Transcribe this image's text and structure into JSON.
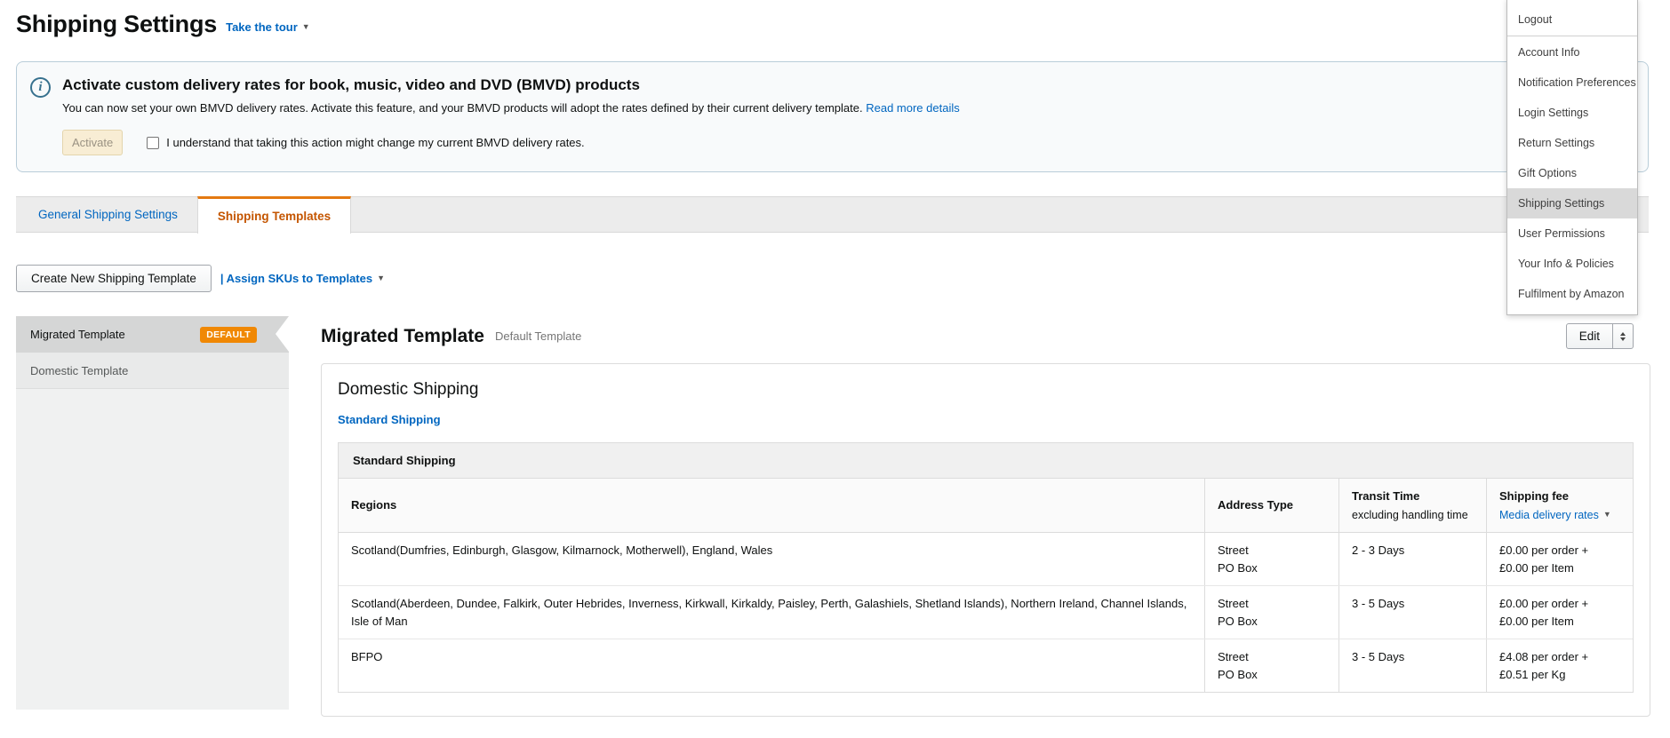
{
  "page": {
    "title": "Shipping Settings",
    "tour_link": "Take the tour"
  },
  "banner": {
    "info_icon": "i",
    "title": "Activate custom delivery rates for book, music, video and DVD (BMVD) products",
    "body": "You can now set your own BMVD delivery rates. Activate this feature, and your BMVD products will adopt the rates defined by their current delivery template.",
    "read_more": "Read more details",
    "activate_button": "Activate",
    "checkbox_label": "I understand that taking this action might change my current BMVD delivery rates.",
    "checkbox_checked": false
  },
  "tabs": {
    "general": "General Shipping Settings",
    "templates": "Shipping Templates",
    "active": "Shipping Templates"
  },
  "toolbar": {
    "create_button": "Create New Shipping Template",
    "assign_link": "| Assign SKUs to Templates"
  },
  "sidebar": {
    "items": [
      {
        "label": "Migrated Template",
        "badge": "DEFAULT",
        "selected": true
      },
      {
        "label": "Domestic Template",
        "selected": false
      }
    ]
  },
  "template_header": {
    "title": "Migrated Template",
    "subtitle": "Default Template",
    "edit_button": "Edit"
  },
  "domestic": {
    "heading": "Domestic Shipping",
    "shipping_option_link": "Standard Shipping"
  },
  "shipping_table": {
    "title": "Standard Shipping",
    "columns": {
      "regions": "Regions",
      "address_type": "Address Type",
      "transit_time": "Transit Time",
      "transit_sub": "excluding handling time",
      "fee": "Shipping fee",
      "fee_link": "Media delivery rates"
    },
    "rows": [
      {
        "regions": "Scotland(Dumfries, Edinburgh, Glasgow, Kilmarnock, Motherwell), England, Wales",
        "address_line1": "Street",
        "address_line2": "PO Box",
        "transit": "2 - 3 Days",
        "fee_line1": "£0.00 per order +",
        "fee_line2": "£0.00 per Item"
      },
      {
        "regions": "Scotland(Aberdeen, Dundee, Falkirk, Outer Hebrides, Inverness, Kirkwall, Kirkaldy, Paisley, Perth, Galashiels, Shetland Islands), Northern Ireland, Channel Islands, Isle of Man",
        "address_line1": "Street",
        "address_line2": "PO Box",
        "transit": "3 - 5 Days",
        "fee_line1": "£0.00 per order +",
        "fee_line2": "£0.00 per Item"
      },
      {
        "regions": "BFPO",
        "address_line1": "Street",
        "address_line2": "PO Box",
        "transit": "3 - 5 Days",
        "fee_line1": "£4.08 per order +",
        "fee_line2": "£0.51 per Kg"
      }
    ]
  },
  "menu": {
    "items": [
      "Logout",
      "Account Info",
      "Notification Preferences",
      "Login Settings",
      "Return Settings",
      "Gift Options",
      "Shipping Settings",
      "User Permissions",
      "Your Info & Policies",
      "Fulfilment by Amazon"
    ],
    "selected": "Shipping Settings"
  },
  "colors": {
    "link_blue": "#0066c0",
    "active_tab_orange": "#c45500",
    "tab_border_orange": "#e47911",
    "default_badge_orange": "#f08804",
    "menu_highlight": "#d9d9d9",
    "banner_border": "#b9cdd9"
  }
}
